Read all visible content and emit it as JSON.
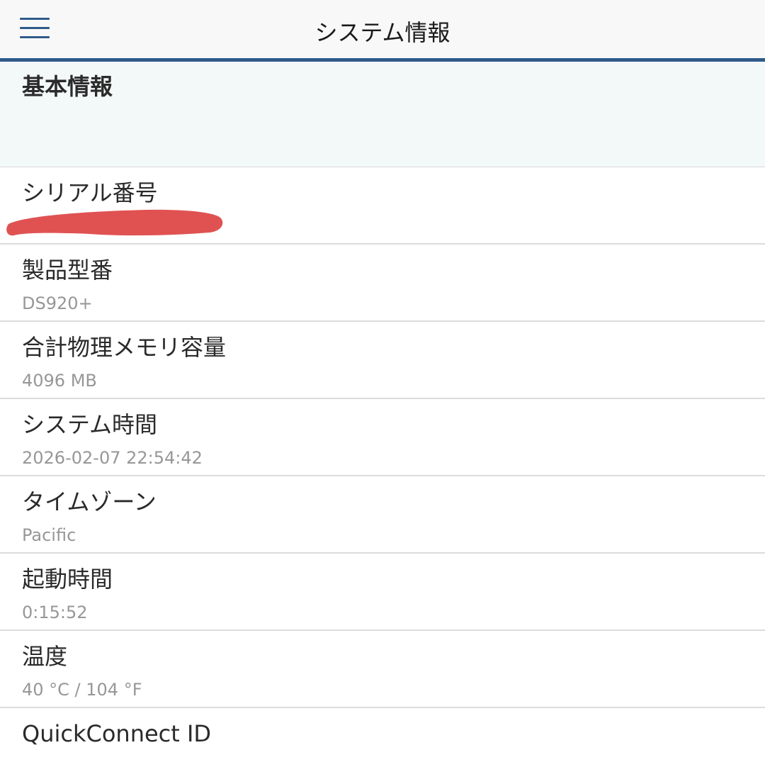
{
  "header": {
    "title": "システム情報",
    "menu_icon": "hamburger-menu-icon",
    "accent_color": "#2f5b8a"
  },
  "section": {
    "title": "基本情報"
  },
  "items": [
    {
      "label": "シリアル番号",
      "value": ""
    },
    {
      "label": "製品型番",
      "value": "DS920+"
    },
    {
      "label": "合計物理メモリ容量",
      "value": "4096 MB"
    },
    {
      "label": "システム時間",
      "value": "2026-02-07 22:54:42"
    },
    {
      "label": "タイムゾーン",
      "value": "Pacific"
    },
    {
      "label": "起動時間",
      "value": "0:15:52"
    },
    {
      "label": "温度",
      "value": "40 °C / 104 °F"
    },
    {
      "label": "QuickConnect ID",
      "value": ""
    }
  ],
  "redaction_color": "#e05252"
}
